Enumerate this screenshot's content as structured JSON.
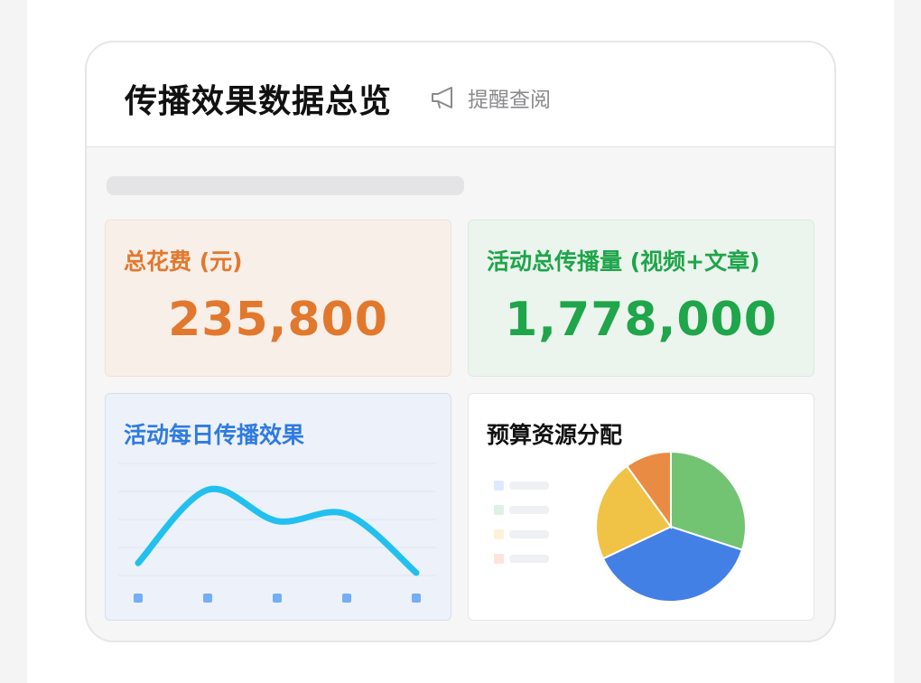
{
  "header": {
    "title": "传播效果数据总览",
    "remind_label": "提醒查阅",
    "remind_icon": "megaphone-icon"
  },
  "stats": {
    "spend_label": "总花费 (元)",
    "spend_value": "235,800",
    "reach_label": "活动总传播量 (视频+文章)",
    "reach_value": "1,778,000"
  },
  "daily": {
    "title": "活动每日传播效果"
  },
  "budget": {
    "title": "预算资源分配"
  },
  "colors": {
    "orange": "#e2782d",
    "green": "#1fa54a",
    "blue": "#2f7be0",
    "line": "#22c0ef",
    "marker": "#74aef5"
  },
  "chart_data": [
    {
      "type": "line",
      "title": "活动每日传播效果",
      "x": [
        1,
        2,
        3,
        4,
        5
      ],
      "series": [
        {
          "values": [
            0.1,
            0.85,
            0.53,
            0.6,
            0.0
          ]
        }
      ],
      "grid": true,
      "legend": "none"
    },
    {
      "type": "pie",
      "title": "预算资源分配",
      "slices": [
        {
          "value": 30,
          "color": "#72c472"
        },
        {
          "value": 38,
          "color": "#4380e6"
        },
        {
          "value": 22,
          "color": "#f0c246"
        },
        {
          "value": 10,
          "color": "#ea8b44"
        }
      ],
      "legend": "left",
      "legend_swatches": [
        "#ddeafc",
        "#ddf2e2",
        "#fdf1d7",
        "#fde4dd"
      ]
    }
  ]
}
